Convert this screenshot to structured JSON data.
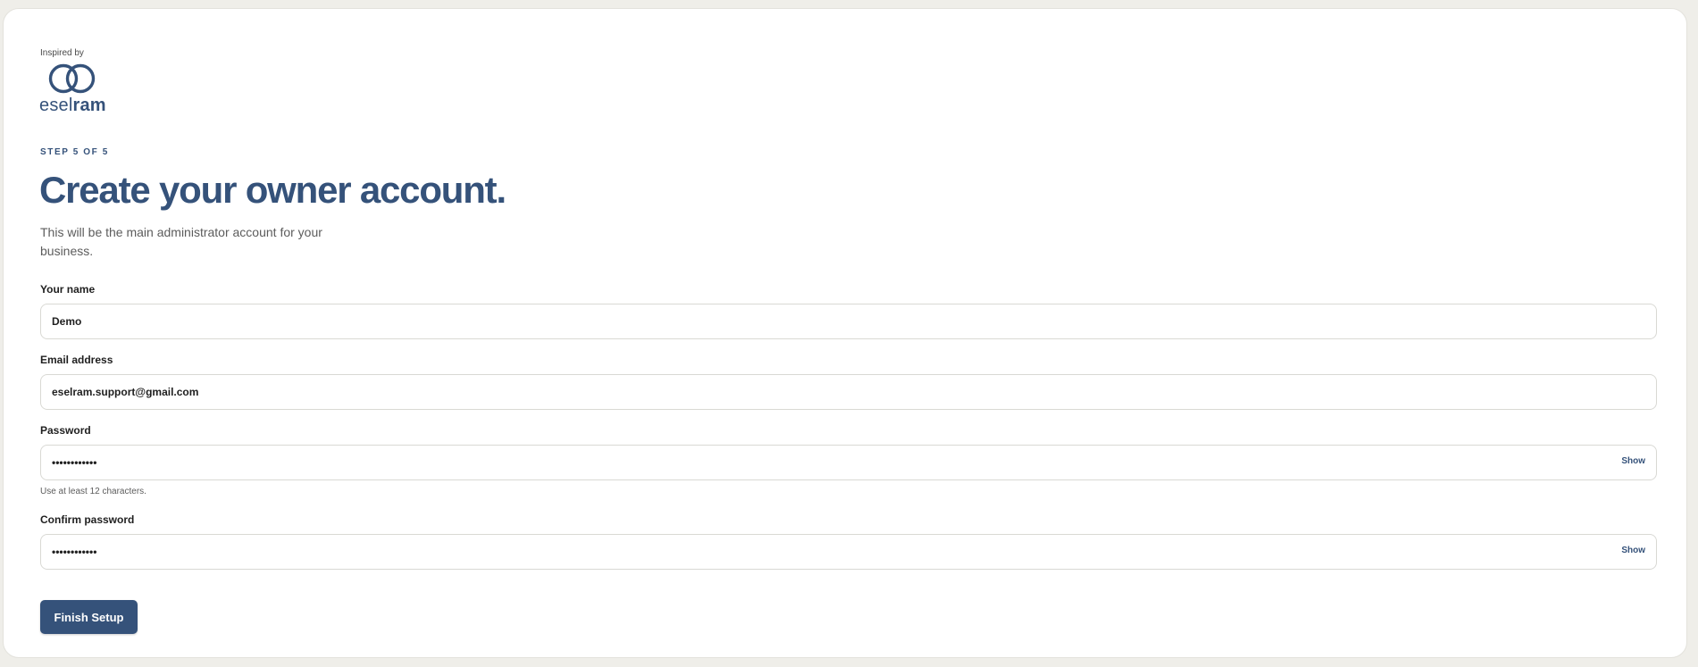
{
  "brand": {
    "inspired_by": "Inspired by",
    "logo_part1": "esel",
    "logo_part2": "ram",
    "accent_color": "#35527a"
  },
  "step": "STEP 5 OF 5",
  "title": "Create your owner account.",
  "subtitle": "This will be the main administrator account for your business.",
  "fields": {
    "name": {
      "label": "Your name",
      "value": "Demo"
    },
    "email": {
      "label": "Email address",
      "value": "eselram.support@gmail.com"
    },
    "password": {
      "label": "Password",
      "value": "••••••••••••",
      "toggle": "Show",
      "hint": "Use at least 12 characters."
    },
    "confirm": {
      "label": "Confirm password",
      "value": "••••••••••••",
      "toggle": "Show"
    }
  },
  "finish_label": "Finish Setup"
}
